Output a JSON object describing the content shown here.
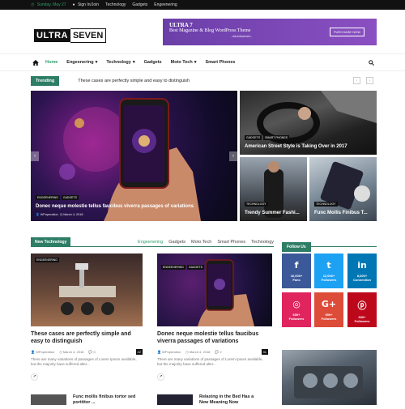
{
  "topbar": {
    "date": "Sunday, May 27",
    "signin": "Sign In/Join",
    "links": [
      "Technology",
      "Gadgets",
      "Engeenering"
    ]
  },
  "logo": {
    "part1": "ULTRA",
    "part2": "SEVEN"
  },
  "ad": {
    "title": "ULTRA 7",
    "subtitle": "Best Magazine & Blog WordPress Theme",
    "note": "- Advertisement -",
    "button": "PURCHASE NOW"
  },
  "nav": {
    "items": [
      {
        "label": "Home"
      },
      {
        "label": "Engeenering"
      },
      {
        "label": "Technology"
      },
      {
        "label": "Gadgets"
      },
      {
        "label": "Moto Tech"
      },
      {
        "label": "Smart Phones"
      }
    ]
  },
  "trending": {
    "label": "Trending",
    "text": "These cases are perfectly simple and easy to distinguish"
  },
  "featured": {
    "big": {
      "tags": [
        "ENGEENERING",
        "GADGETS"
      ],
      "title": "Donec neque molestie tellus faucibus viverra passages of variations",
      "author": "WPoperation",
      "date": "March 4, 2018"
    },
    "tr": {
      "tags": [
        "GADGETS",
        "SMART PHONES"
      ],
      "title": "American Street Style is Taking Over in 2017"
    },
    "bl": {
      "tags": [
        "TECHNOLOGY"
      ],
      "title": "Trendy Summer Fashi..."
    },
    "br": {
      "tags": [
        "TECHNOLOGY"
      ],
      "title": "Func Mollis Finibus T..."
    }
  },
  "section": {
    "label": "New Technology",
    "tabs": [
      "Engeenering",
      "Gadgets",
      "Moto Tech",
      "Smart Phones",
      "Technology"
    ]
  },
  "cards": [
    {
      "tag": "ENGEENERING",
      "title": "These cases are perfectly simple and easy to distinguish",
      "author": "WPoperation",
      "date": "March 4, 2018",
      "comments": "0",
      "count": "22",
      "excerpt": "There are many variations of passages of Lorem Ipsum available, but the majority have suffered alter..."
    },
    {
      "tag": "ENGEENERING",
      "tag2": "GADGETS",
      "title": "Donec neque molestie tellus faucibus viverra passages of variations",
      "author": "WPoperation",
      "date": "March 4, 2018",
      "comments": "2",
      "count": "31",
      "excerpt": "There are many variations of passages of Lorem Ipsum available, but the majority have suffered alter..."
    }
  ],
  "follow": {
    "label": "Follow Us",
    "items": [
      {
        "icon": "f",
        "count": "16,000+",
        "label": "Fans",
        "color": "#3b5998"
      },
      {
        "icon": "t",
        "count": "12,000+",
        "label": "Followers",
        "color": "#1da1f2"
      },
      {
        "icon": "in",
        "count": "8,000+",
        "label": "Connection",
        "color": "#0077b5"
      },
      {
        "icon": "P",
        "count": "600+",
        "label": "Followers",
        "color": "#e0245e"
      },
      {
        "icon": "G+",
        "count": "900+",
        "label": "Followers",
        "color": "#dd4b39"
      },
      {
        "icon": "P",
        "count": "600+",
        "label": "Followers",
        "color": "#bd081c"
      }
    ]
  },
  "bottom": [
    "Func mollis finibus tortor sed porttitor ...",
    "Relaxing in the Bed Has a New Meaning Now"
  ],
  "colors": {
    "accent": "#2e7d65",
    "accent_text": "#2e9e6e"
  }
}
